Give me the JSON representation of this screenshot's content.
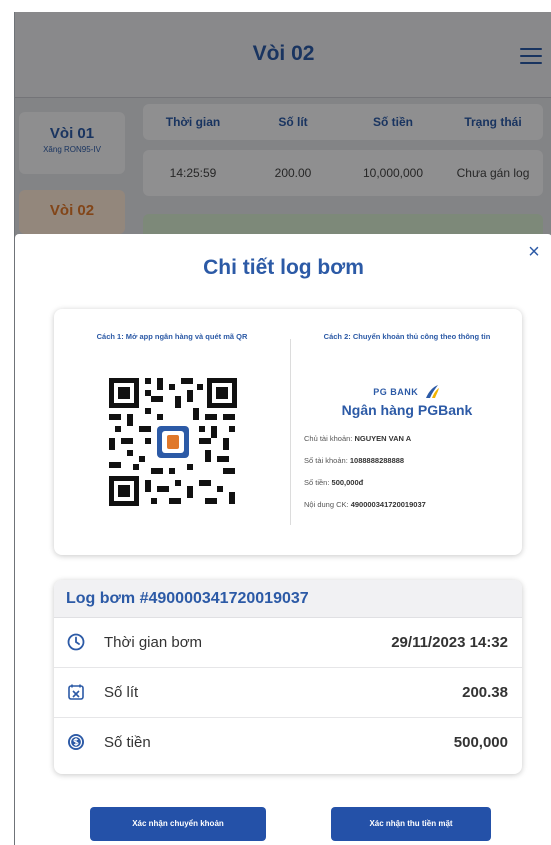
{
  "app": {
    "title": "Vòi 02",
    "nozzles": [
      {
        "name": "Vòi 01",
        "sub": "Xăng RON95-IV"
      },
      {
        "name": "Vòi 02"
      }
    ],
    "table_headers": [
      "Thời gian",
      "Số lít",
      "Số tiền",
      "Trạng thái"
    ],
    "rows": [
      [
        "14:25:59",
        "200.00",
        "10,000,000",
        "Chưa gán log"
      ]
    ]
  },
  "modal": {
    "title": "Chi tiết log bơm",
    "close_icon": "×",
    "method1": "Cách 1: Mở app ngân hàng và quét mã QR",
    "method2": "Cách 2: Chuyển khoản thủ công theo thông tin",
    "bank_logo_text": "PG BANK",
    "bank_name": "Ngân hàng PGBank",
    "account_holder_label": "Chủ tài khoản:",
    "account_holder": "NGUYEN VAN A",
    "account_number_label": "Số tài khoản:",
    "account_number": "1088888288888",
    "amount_label": "Số tiền:",
    "amount": "500,000đ",
    "content_label": "Nội dung CK:",
    "content": "490000341720019037",
    "log": {
      "title": "Log bơm #490000341720019037",
      "rows": [
        {
          "icon": "clock-icon",
          "label": "Thời gian bơm",
          "value": "29/11/2023 14:32"
        },
        {
          "icon": "fuel-calendar-icon",
          "label": "Số lít",
          "value": "200.38"
        },
        {
          "icon": "money-icon",
          "label": "Số tiền",
          "value": "500,000"
        }
      ]
    },
    "btn_confirm_transfer": "Xác nhận chuyển khoản",
    "btn_confirm_cash": "Xác nhận thu tiền mặt"
  },
  "colors": {
    "primary": "#2c5aa6",
    "button": "#2451a8",
    "accent": "#e0782a"
  }
}
